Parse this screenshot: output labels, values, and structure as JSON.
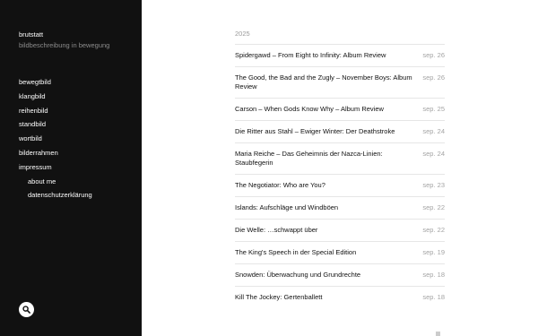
{
  "site": {
    "title": "brutstatt",
    "description": "bildbeschreibung in bewegung"
  },
  "nav": [
    {
      "label": "bewegtbild"
    },
    {
      "label": "klangbild"
    },
    {
      "label": "reihenbild"
    },
    {
      "label": "standbild"
    },
    {
      "label": "wortbild"
    },
    {
      "label": "bilderrahmen"
    },
    {
      "label": "impressum"
    },
    {
      "label": "about me"
    },
    {
      "label": "datenschutzerklärung"
    }
  ],
  "search": {
    "icon": "search-icon"
  },
  "archive": {
    "year": "2025",
    "posts": [
      {
        "title": "Spidergawd – From Eight to Infinity: Album Review",
        "date": "sep. 26"
      },
      {
        "title": "The Good, the Bad and the Zugly – November Boys: Album Review",
        "date": "sep. 26"
      },
      {
        "title": "Carson – When Gods Know Why – Album Review",
        "date": "sep. 25"
      },
      {
        "title": "Die Ritter aus Stahl – Ewiger Winter: Der Deathstroke",
        "date": "sep. 24"
      },
      {
        "title": "Maria Reiche – Das Geheimnis der Nazca-Linien: Staubfegerin",
        "date": "sep. 24"
      },
      {
        "title": "The Negotiator: Who are You?",
        "date": "sep. 23"
      },
      {
        "title": "Islands: Aufschläge und Windböen",
        "date": "sep. 22"
      },
      {
        "title": "Die Welle: …schwappt über",
        "date": "sep. 22"
      },
      {
        "title": "The King's Speech in der Special Edition",
        "date": "sep. 19"
      },
      {
        "title": "Snowden: Überwachung und Grundrechte",
        "date": "sep. 18"
      },
      {
        "title": "Kill The Jockey: Gertenballett",
        "date": "sep. 18"
      }
    ]
  }
}
